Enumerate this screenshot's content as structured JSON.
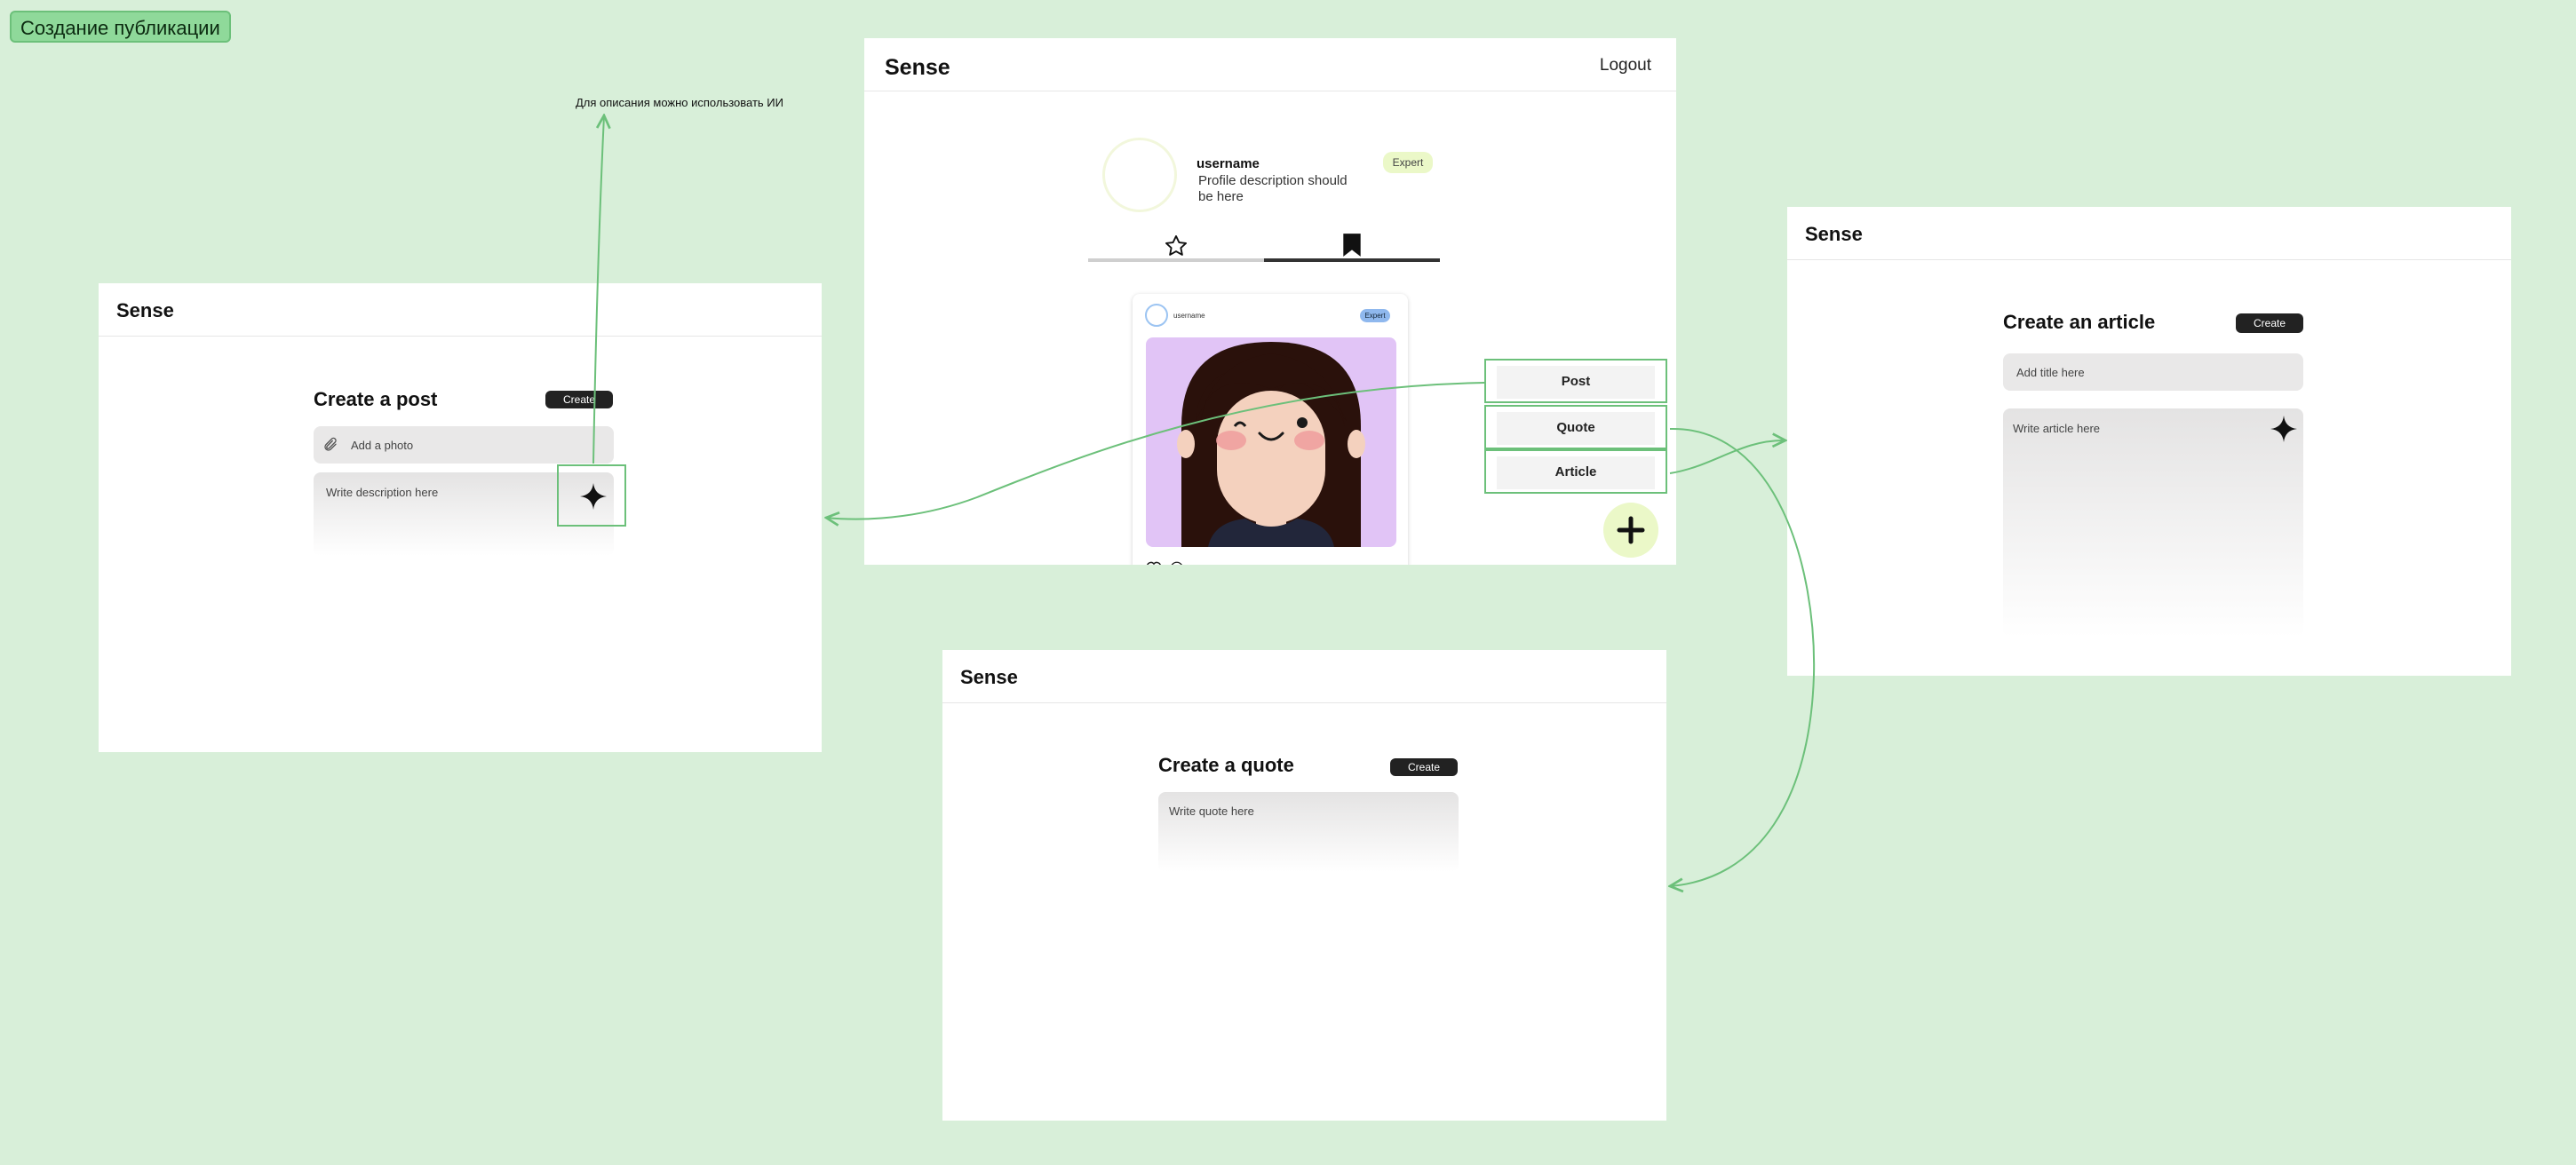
{
  "board": {
    "title": "Создание публикации",
    "ai_note": "Для описания можно использовать ИИ"
  },
  "profile_screen": {
    "brand": "Sense",
    "logout": "Logout",
    "profile": {
      "username": "username",
      "description": "Profile description should be here",
      "badge": "Expert"
    },
    "tabs": [
      {
        "icon": "star-icon",
        "selected": false
      },
      {
        "icon": "bookmark-icon",
        "selected": true
      }
    ],
    "post_card": {
      "username": "username",
      "badge": "Expert",
      "image": "avatar-girl-illustration",
      "actions": [
        "heart-icon",
        "comment-icon"
      ]
    },
    "create_menu": {
      "items": [
        "Post",
        "Quote",
        "Article"
      ],
      "fab_icon": "plus-icon"
    }
  },
  "post_screen": {
    "brand": "Sense",
    "title": "Create a post",
    "create_label": "Create",
    "photo_placeholder": "Add a photo",
    "photo_icon": "paperclip-icon",
    "description_placeholder": "Write description here",
    "ai_icon": "sparkle-icon"
  },
  "article_screen": {
    "brand": "Sense",
    "title": "Create an article",
    "create_label": "Create",
    "title_placeholder": "Add title here",
    "body_placeholder": "Write article here",
    "ai_icon": "sparkle-icon"
  },
  "quote_screen": {
    "brand": "Sense",
    "title": "Create a quote",
    "create_label": "Create",
    "quote_placeholder": "Write quote here"
  },
  "colors": {
    "canvas": "#d8efd9",
    "connector": "#6cc07a",
    "button_dark": "#222222",
    "expert_badge": "#ebf8c8",
    "card_badge": "#8fb8ee",
    "fab": "#ebf8c8",
    "card_image_bg": "#e1c4f6"
  }
}
